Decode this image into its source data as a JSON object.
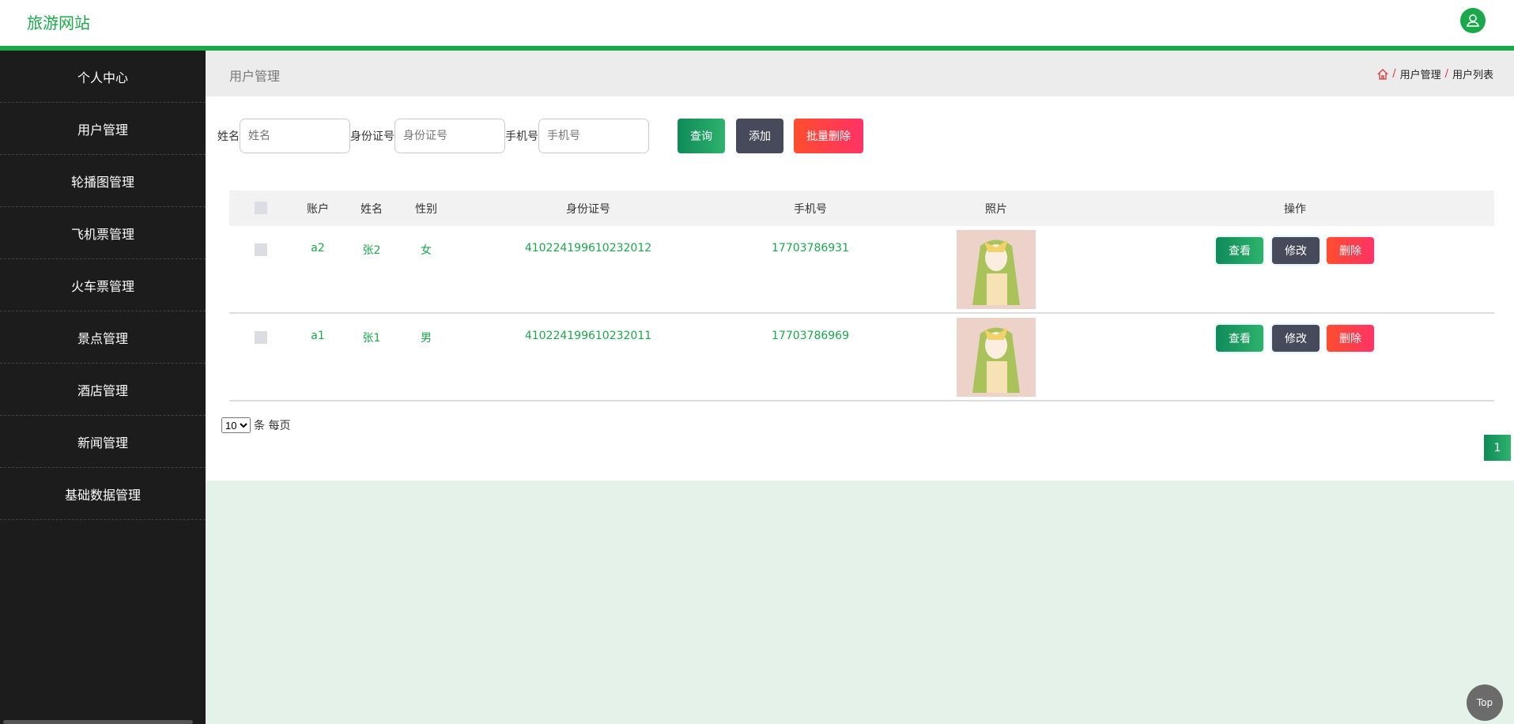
{
  "header": {
    "logo": "旅游网站",
    "avatar_icon": "user-icon"
  },
  "sidebar": {
    "items": [
      {
        "label": "个人中心"
      },
      {
        "label": "用户管理"
      },
      {
        "label": "轮播图管理"
      },
      {
        "label": "飞机票管理"
      },
      {
        "label": "火车票管理"
      },
      {
        "label": "景点管理"
      },
      {
        "label": "酒店管理"
      },
      {
        "label": "新闻管理"
      },
      {
        "label": "基础数据管理"
      }
    ]
  },
  "page": {
    "title": "用户管理",
    "breadcrumb": [
      "用户管理",
      "用户列表"
    ]
  },
  "search": {
    "name_label": "姓名",
    "name_placeholder": "姓名",
    "id_label": "身份证号",
    "id_placeholder": "身份证号",
    "phone_label": "手机号",
    "phone_placeholder": "手机号",
    "query": "查询",
    "add": "添加",
    "batch_delete": "批量删除"
  },
  "table": {
    "headers": [
      "账户",
      "姓名",
      "性别",
      "身份证号",
      "手机号",
      "照片",
      "操作"
    ],
    "rows": [
      {
        "account": "a2",
        "name": "张2",
        "gender": "女",
        "id_number": "410224199610232012",
        "phone": "17703786931"
      },
      {
        "account": "a1",
        "name": "张1",
        "gender": "男",
        "id_number": "410224199610232011",
        "phone": "17703786969"
      }
    ],
    "actions": {
      "view": "查看",
      "edit": "修改",
      "delete": "删除"
    }
  },
  "pagination": {
    "page_size": "10",
    "page_size_suffix": "条 每页",
    "current_page": "1"
  },
  "to_top": "Top",
  "colors": {
    "accent": "#1aa84a",
    "sidebar": "#1c1c1c",
    "danger": "#ff4d2e"
  }
}
